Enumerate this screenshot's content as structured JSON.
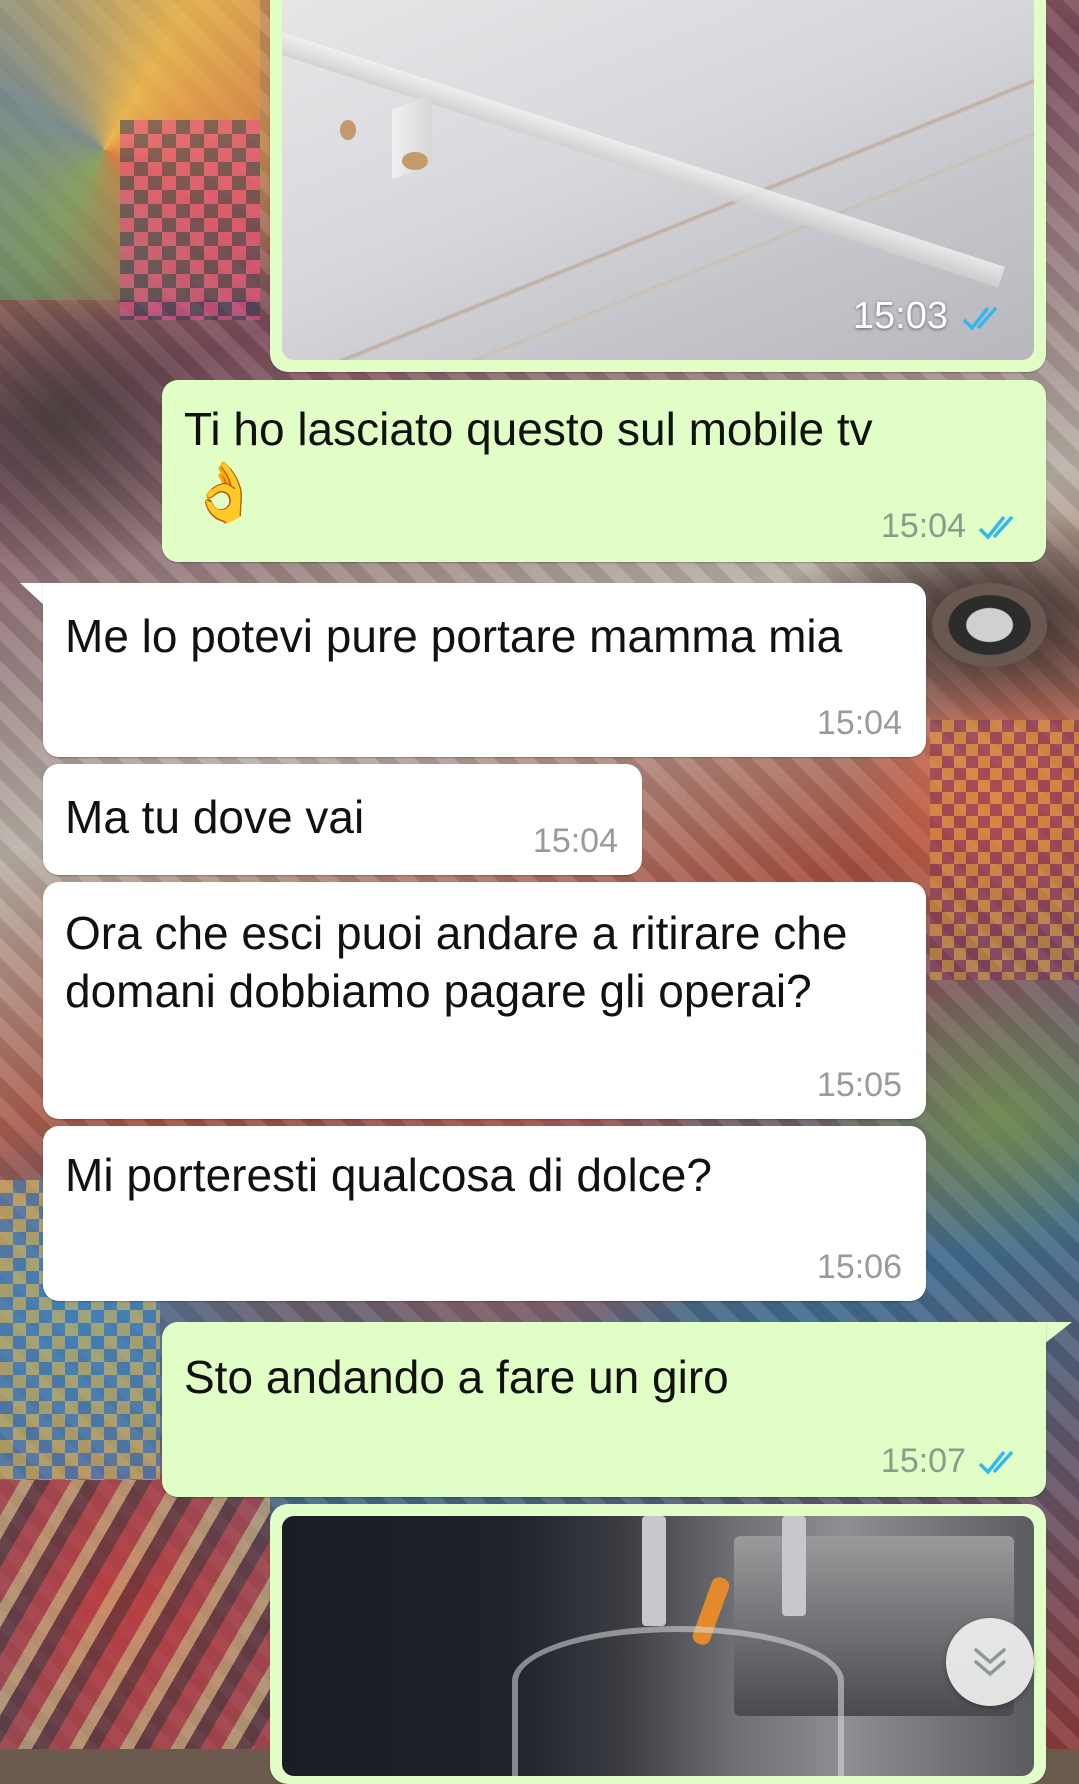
{
  "chat": {
    "messages": [
      {
        "type": "image",
        "direction": "out",
        "time": "15:03",
        "status": "read"
      },
      {
        "type": "text",
        "direction": "out",
        "text": "Ti ho lasciato questo sul mobile tv",
        "emoji": "👌",
        "time": "15:04",
        "status": "read"
      },
      {
        "type": "text",
        "direction": "in",
        "text": "Me lo potevi pure portare mamma mia",
        "time": "15:04"
      },
      {
        "type": "text",
        "direction": "in",
        "text": "Ma tu dove vai",
        "time": "15:04"
      },
      {
        "type": "text",
        "direction": "in",
        "text": "Ora che esci puoi andare a ritirare che domani dobbiamo pagare gli operai?",
        "time": "15:05"
      },
      {
        "type": "text",
        "direction": "in",
        "text": "Mi porteresti qualcosa di dolce?",
        "time": "15:06"
      },
      {
        "type": "text",
        "direction": "out",
        "text": "Sto andando a fare un giro",
        "time": "15:07",
        "status": "read"
      },
      {
        "type": "image",
        "direction": "out",
        "time": "",
        "status": ""
      }
    ]
  },
  "colors": {
    "outgoing_bubble": "#e1fec6",
    "incoming_bubble": "#ffffff",
    "read_ticks": "#34b7f1",
    "timestamp": "#8c9a8a"
  },
  "icons": {
    "read_receipt": "double-check-icon",
    "scroll_down": "double-chevron-down-icon"
  }
}
